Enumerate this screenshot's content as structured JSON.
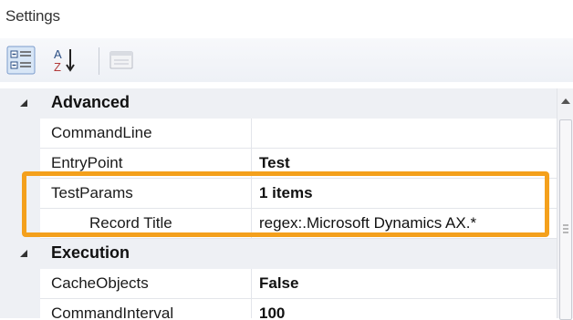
{
  "window": {
    "title": "Settings"
  },
  "toolbar": {
    "buttons": [
      {
        "icon": "categorized-icon",
        "tooltip": "Categorized"
      },
      {
        "icon": "alphabetical-sort-icon",
        "tooltip": "Alphabetical"
      },
      {
        "icon": "property-pages-icon",
        "tooltip": "Property Pages"
      }
    ]
  },
  "property_grid": {
    "categories": [
      {
        "name": "Advanced",
        "rows": [
          {
            "name": "CommandLine",
            "value": ""
          },
          {
            "name": "EntryPoint",
            "value": "Test"
          },
          {
            "name": "TestParams",
            "value": "1 items"
          },
          {
            "name": "Record Title",
            "value": "regex:.Microsoft Dynamics AX.*"
          }
        ]
      },
      {
        "name": "Execution",
        "rows": [
          {
            "name": "CacheObjects",
            "value": "False"
          },
          {
            "name": "CommandInterval",
            "value": "100"
          }
        ]
      }
    ]
  },
  "colors": {
    "highlight": "#f4a01c",
    "gutter": "#eef0f4",
    "grid_line": "#e3e5ea"
  }
}
